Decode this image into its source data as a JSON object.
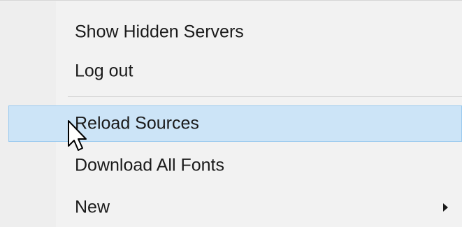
{
  "menu": {
    "items": [
      {
        "label": "Show Hidden Servers"
      },
      {
        "label": "Log out"
      },
      {
        "label": "Reload Sources"
      },
      {
        "label": "Download All Fonts"
      },
      {
        "label": "New"
      }
    ]
  },
  "colors": {
    "highlight_fill": "#cce4f7",
    "highlight_border": "#99c9ef",
    "menu_background": "#f2f2f2",
    "text": "#1a1a1a"
  },
  "icons": {
    "submenu": "chevron-right-icon",
    "pointer": "mouse-cursor-icon"
  }
}
